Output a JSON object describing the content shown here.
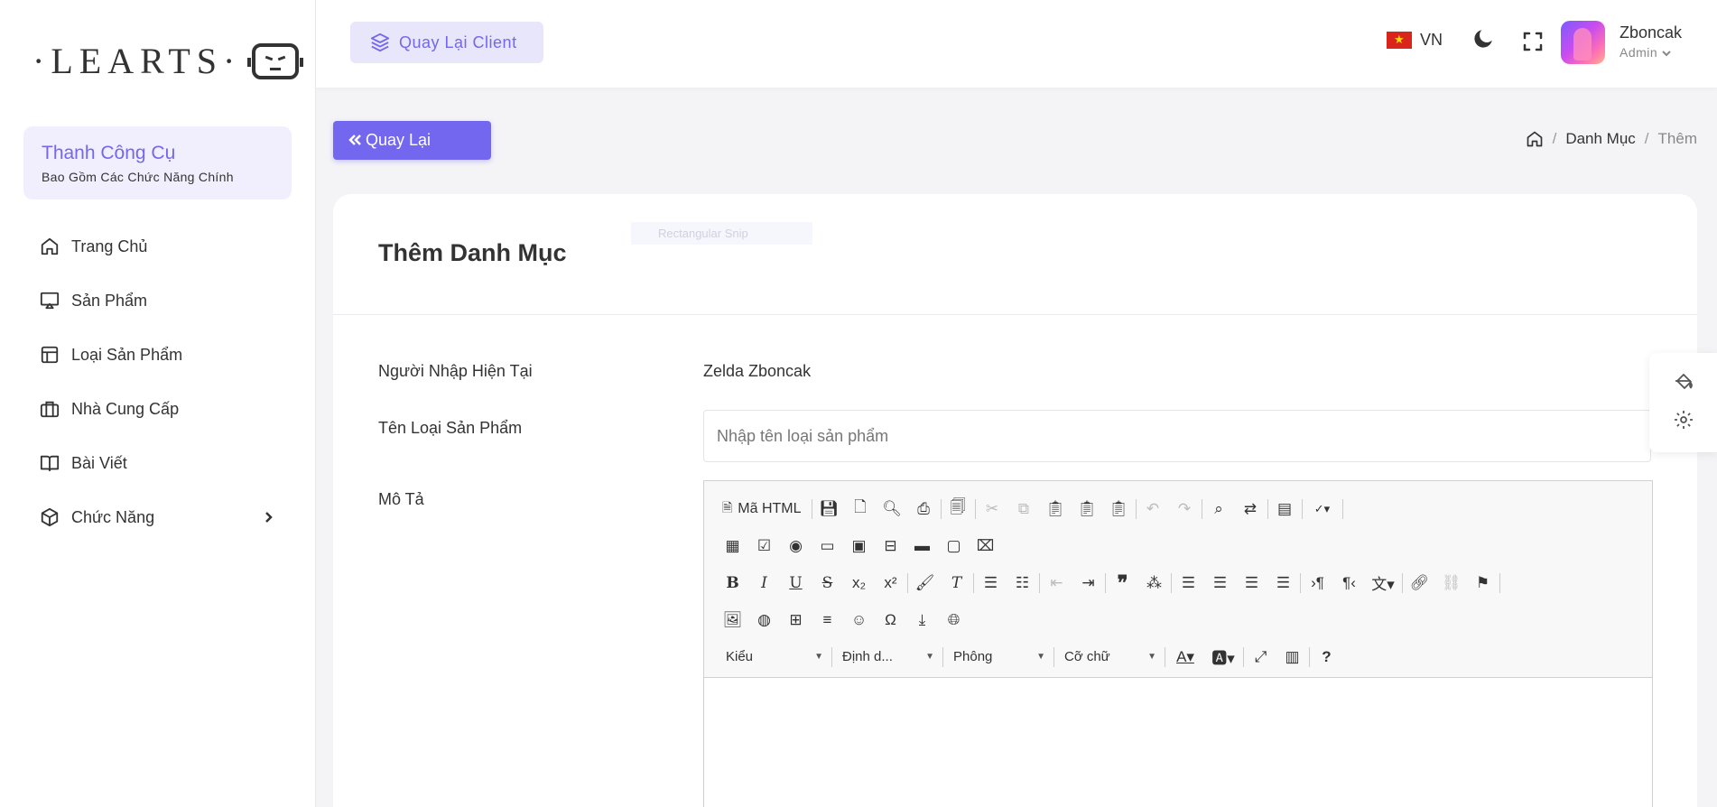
{
  "sidebar": {
    "logo_text": "·LEARTS·",
    "tool_card": {
      "title": "Thanh Công Cụ",
      "subtitle": "Bao Gồm Các Chức Năng Chính"
    },
    "items": [
      {
        "label": "Trang Chủ",
        "icon": "home-icon"
      },
      {
        "label": "Sản Phẩm",
        "icon": "monitor-icon"
      },
      {
        "label": "Loại Sản Phẩm",
        "icon": "layout-icon"
      },
      {
        "label": "Nhà Cung Cấp",
        "icon": "briefcase-icon"
      },
      {
        "label": "Bài Viết",
        "icon": "book-icon"
      },
      {
        "label": "Chức Năng",
        "icon": "box-icon"
      }
    ]
  },
  "header": {
    "client_button": "Quay Lại Client",
    "language": "VN",
    "user_name": "Zboncak",
    "user_role": "Admin"
  },
  "page": {
    "back_button": "Quay Lại",
    "breadcrumb": [
      "Danh Mục",
      "Thêm"
    ],
    "card_title": "Thêm Danh Mục",
    "ghost_text": "Rectangular Snip"
  },
  "form": {
    "creator_label": "Người Nhập Hiện Tại",
    "creator_value": "Zelda Zboncak",
    "name_label": "Tên Loại Sản Phẩm",
    "name_placeholder": "Nhập tên loại sản phẩm",
    "desc_label": "Mô Tả"
  },
  "editor": {
    "source_label": "Mã HTML",
    "combos": [
      "Kiểu",
      "Định d...",
      "Phông",
      "Cỡ chữ"
    ]
  },
  "colors": {
    "accent": "#7367f0",
    "accent_light": "#f1effd"
  }
}
